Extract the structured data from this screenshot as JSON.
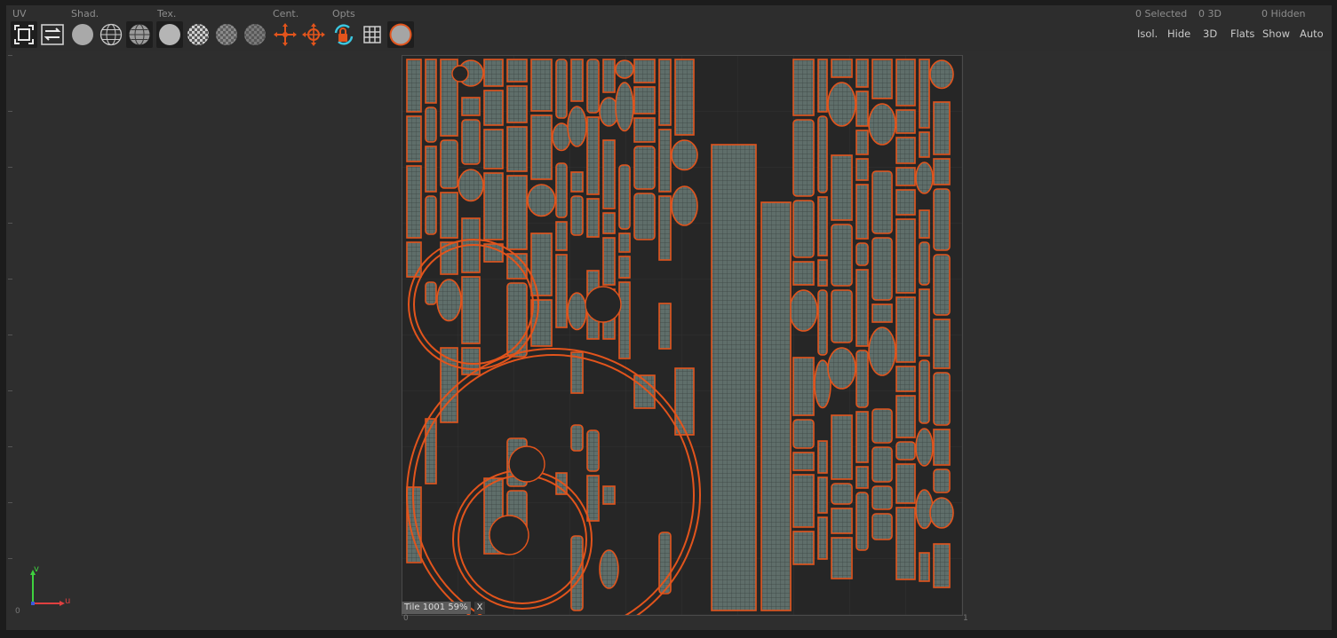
{
  "toolbar": {
    "section_labels": {
      "uv": "UV",
      "shading": "Shad.",
      "texture": "Tex.",
      "center": "Cent.",
      "options": "Opts"
    },
    "stats": {
      "selected": "0 Selected",
      "three_d": "0 3D",
      "hidden": "0 Hidden"
    },
    "right_buttons": {
      "isolate": "Isol.",
      "hide": "Hide",
      "three_d": "3D",
      "flats": "Flats",
      "show": "Show",
      "auto": "Auto"
    }
  },
  "viewport": {
    "tile_label": "Tile 1001 59%",
    "tile_close": "X",
    "axis": {
      "v": "v",
      "u": "u",
      "origin": "0"
    },
    "uv_origin_label": "0",
    "uv_corner_label": "1"
  },
  "colors": {
    "uv_island_outline": "#e2541c",
    "uv_island_fill": "#5f6e6a",
    "axis_v": "#3fd13f",
    "axis_u": "#e04040",
    "background": "#2e2e2e"
  },
  "icons": [
    "select-frame-icon",
    "swap-icon",
    "flat-sphere-icon",
    "wire-sphere-icon",
    "shaded-wire-sphere-icon",
    "solid-sphere-icon",
    "checker-sphere-icon",
    "checker-sphere-dim-icon",
    "checker-sphere-dim2-icon",
    "center-move-icon",
    "center-target-icon",
    "lock-rotate-icon",
    "grid-icon",
    "orange-sphere-icon"
  ]
}
